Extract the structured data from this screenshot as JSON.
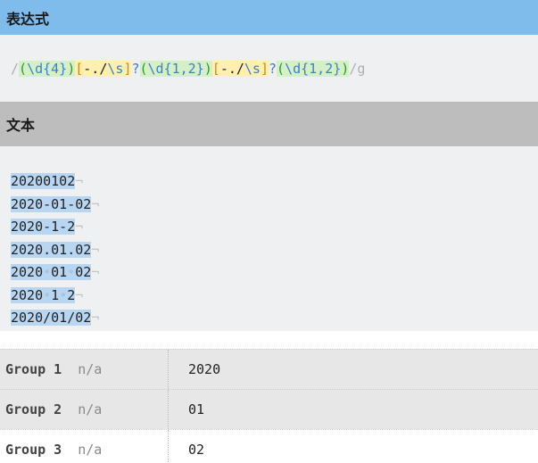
{
  "expression_header": {
    "title": "表达式"
  },
  "expression": {
    "open_slash": "/",
    "g1_open": "(",
    "g1_d": "\\d",
    "g1_q": "{4}",
    "g1_close": ")",
    "s1_open": "[",
    "s1_chars": "-./",
    "s1_esc": "\\s",
    "s1_close": "]",
    "s1_opt": "?",
    "g2_open": "(",
    "g2_d": "\\d",
    "g2_q": "{1,2}",
    "g2_close": ")",
    "s2_open": "[",
    "s2_chars": "-./",
    "s2_esc": "\\s",
    "s2_close": "]",
    "s2_opt": "?",
    "g3_open": "(",
    "g3_d": "\\d",
    "g3_q": "{1,2}",
    "g3_close": ")",
    "close_slash": "/",
    "flags": "g"
  },
  "text_header": {
    "title": "文本"
  },
  "text": {
    "eol": "¬",
    "space_marker": "•",
    "lines": [
      {
        "a": "20200102"
      },
      {
        "a": "2020-01-02"
      },
      {
        "a": "2020-1-2"
      },
      {
        "a": "2020.01.02"
      },
      {
        "a": "2020",
        "b": "01",
        "c": "02"
      },
      {
        "a": "2020",
        "b": "1",
        "c": "2"
      },
      {
        "a": "2020/01/02"
      }
    ]
  },
  "groups": [
    {
      "label": "Group 1",
      "na": "n/a",
      "value": "2020"
    },
    {
      "label": "Group 2",
      "na": "n/a",
      "value": "01"
    },
    {
      "label": "Group 3",
      "na": "n/a",
      "value": "02"
    }
  ]
}
